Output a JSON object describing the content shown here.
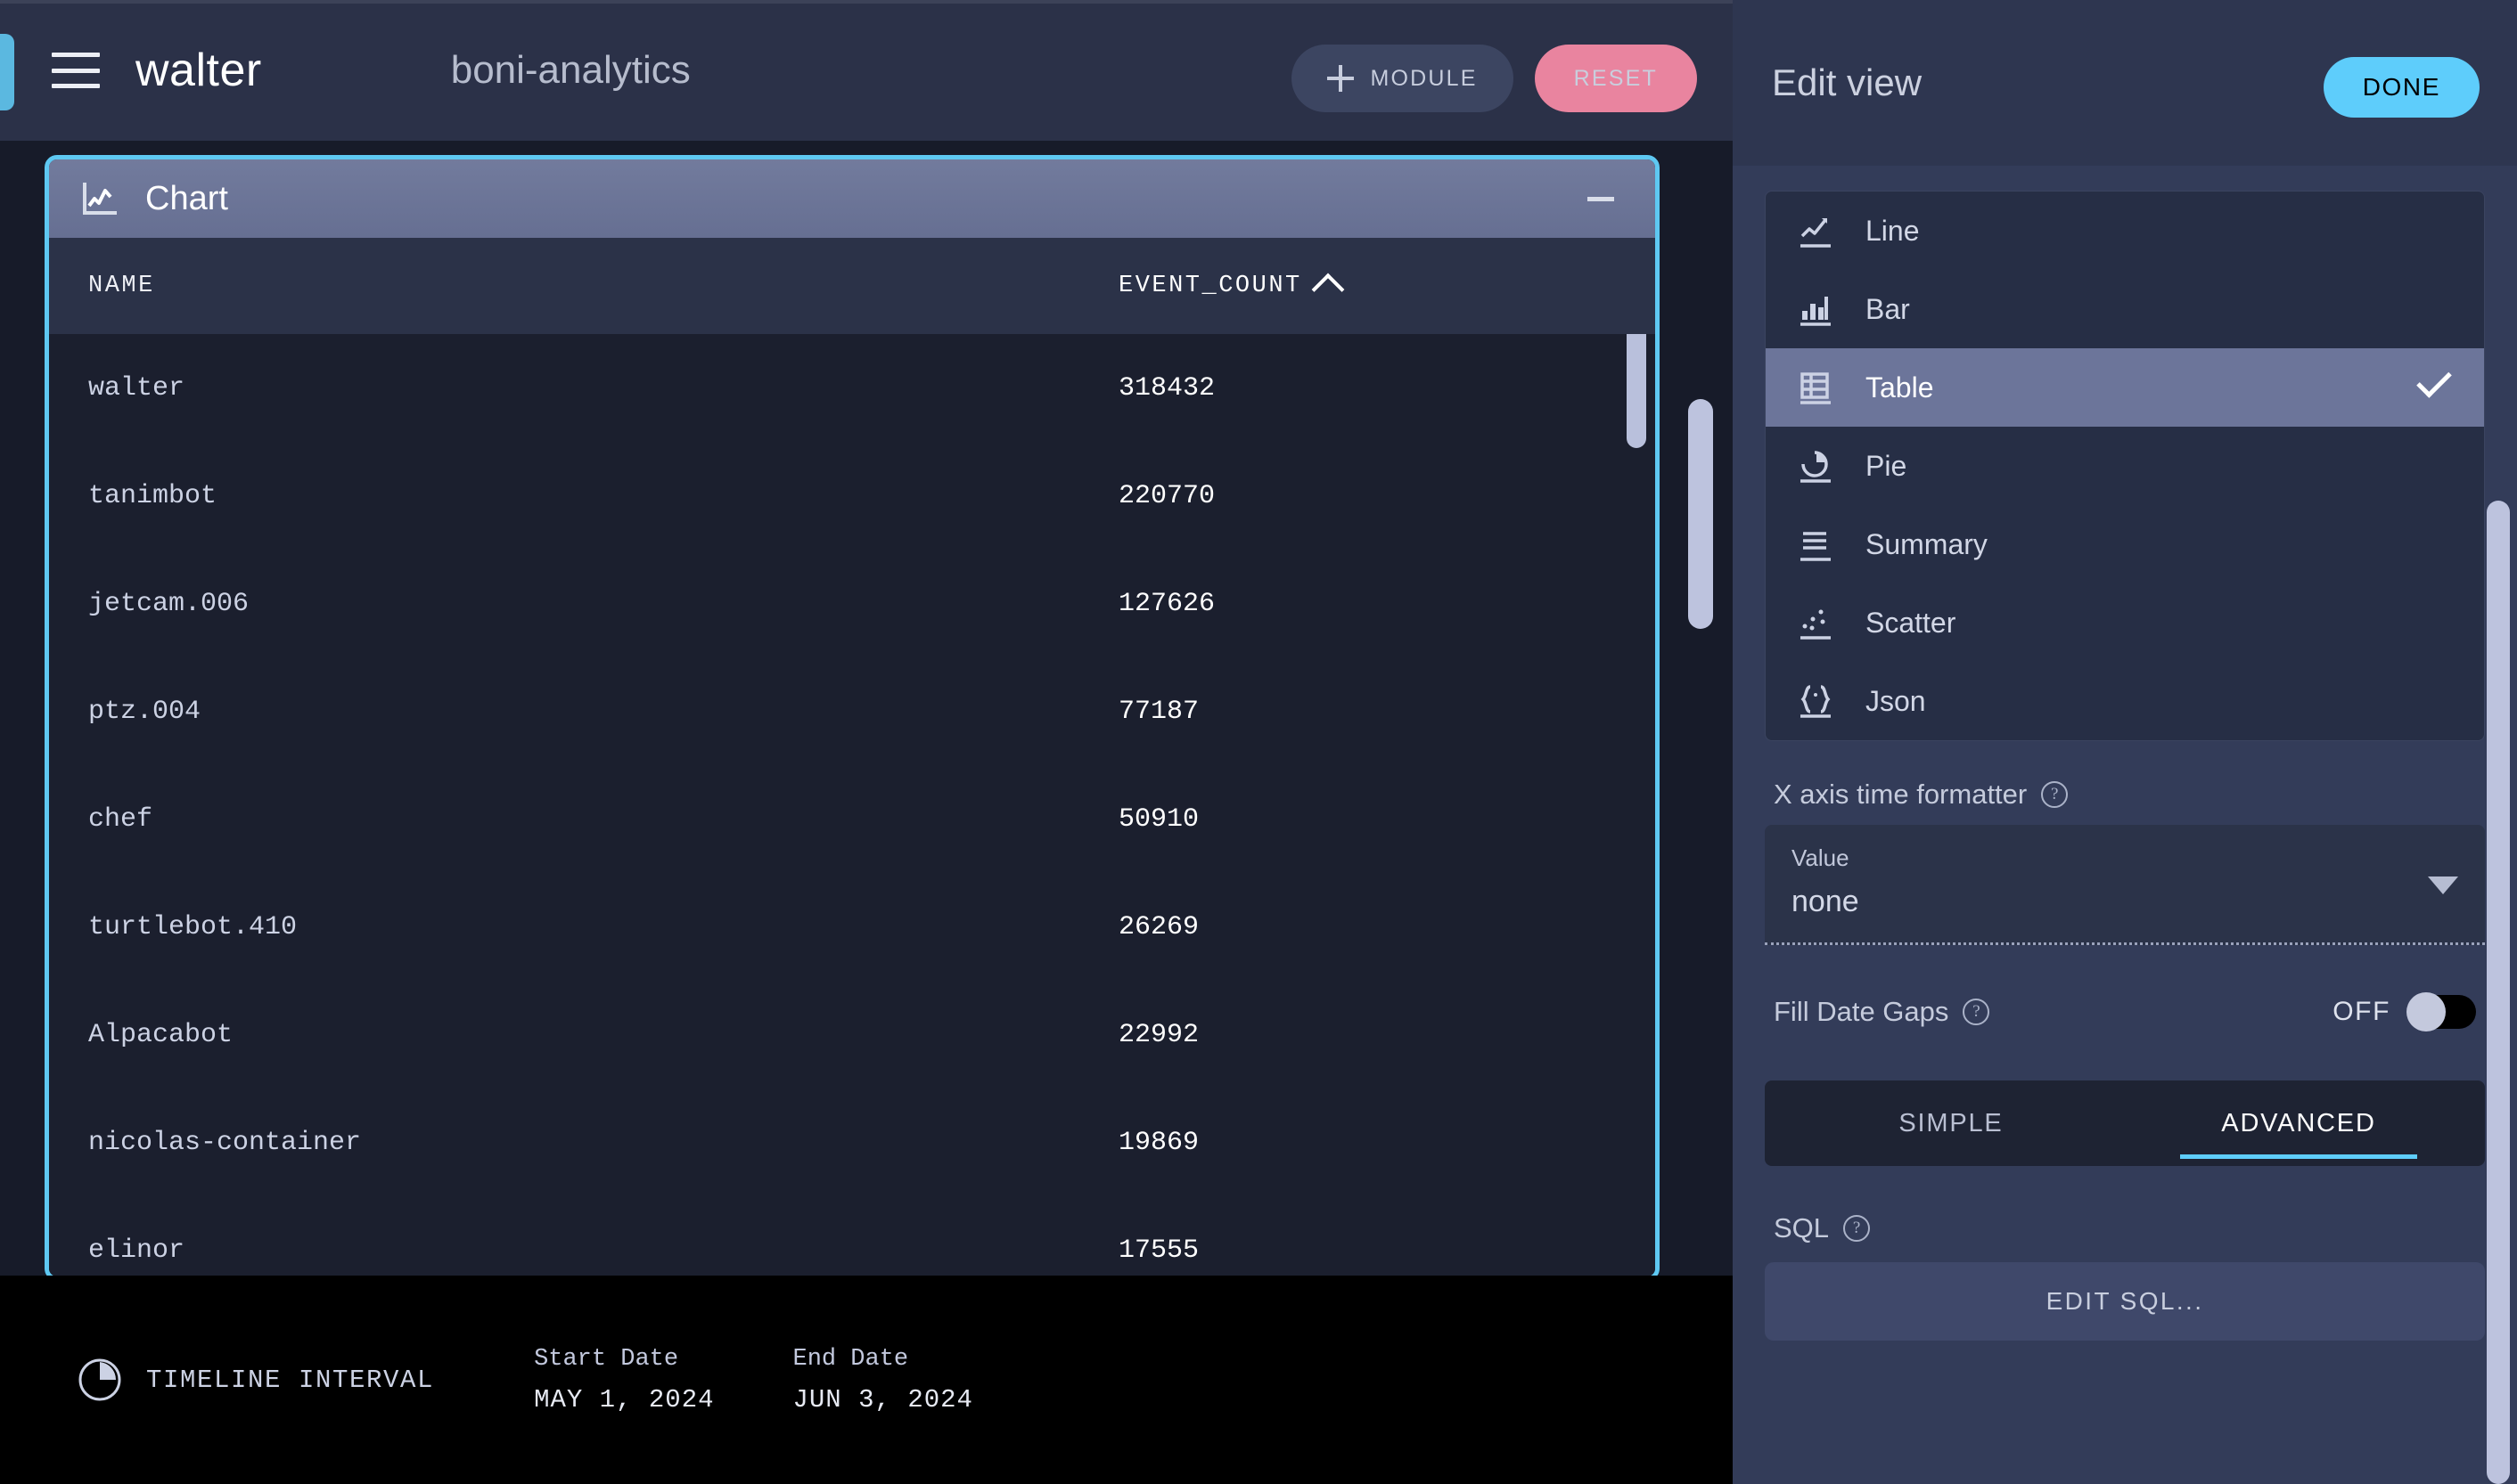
{
  "topbar": {
    "menu_icon": "hamburger-icon",
    "app_title": "walter",
    "board_title": "boni-analytics",
    "module_button": "MODULE",
    "reset_button": "RESET"
  },
  "chart_module": {
    "icon": "line-chart-icon",
    "title": "Chart",
    "minimize_label": "—"
  },
  "chart_data": {
    "type": "table",
    "title": "Chart",
    "columns": [
      "NAME",
      "EVENT_COUNT"
    ],
    "sort_column": "EVENT_COUNT",
    "sort_direction": "ascending",
    "sort_icon": "chevron-up-icon",
    "categories": [
      "walter",
      "tanimbot",
      "jetcam.006",
      "ptz.004",
      "chef",
      "turtlebot.410",
      "Alpacabot",
      "nicolas-container",
      "elinor"
    ],
    "values": [
      318432,
      220770,
      127626,
      77187,
      50910,
      26269,
      22992,
      19869,
      17555
    ],
    "xlabel": "NAME",
    "ylabel": "EVENT_COUNT",
    "rows": [
      {
        "name": "walter",
        "event_count": "318432"
      },
      {
        "name": "tanimbot",
        "event_count": "220770"
      },
      {
        "name": "jetcam.006",
        "event_count": "127626"
      },
      {
        "name": "ptz.004",
        "event_count": "77187"
      },
      {
        "name": "chef",
        "event_count": "50910"
      },
      {
        "name": "turtlebot.410",
        "event_count": "26269"
      },
      {
        "name": "Alpacabot",
        "event_count": "22992"
      },
      {
        "name": "nicolas-container",
        "event_count": "19869"
      },
      {
        "name": "elinor",
        "event_count": "17555"
      }
    ]
  },
  "timeline": {
    "icon": "pie-clock-icon",
    "label": "TIMELINE INTERVAL",
    "start_label": "Start Date",
    "start_value": "MAY 1, 2024",
    "end_label": "End Date",
    "end_value": "JUN 3, 2024"
  },
  "edit_panel": {
    "title": "Edit view",
    "done_button": "DONE",
    "chart_types": [
      {
        "label": "Line",
        "icon": "line-chart-icon",
        "selected": false
      },
      {
        "label": "Bar",
        "icon": "bar-chart-icon",
        "selected": false
      },
      {
        "label": "Table",
        "icon": "table-grid-icon",
        "selected": true
      },
      {
        "label": "Pie",
        "icon": "pie-chart-icon",
        "selected": false
      },
      {
        "label": "Summary",
        "icon": "list-lines-icon",
        "selected": false
      },
      {
        "label": "Scatter",
        "icon": "scatter-plot-icon",
        "selected": false
      },
      {
        "label": "Json",
        "icon": "curly-braces-icon",
        "selected": false
      }
    ],
    "selected_check_icon": "check-icon",
    "x_axis_formatter": {
      "label": "X axis time formatter",
      "help_icon": "question-circle-icon",
      "field_label": "Value",
      "value": "none",
      "caret_icon": "chevron-down-icon"
    },
    "fill_date_gaps": {
      "label": "Fill Date Gaps",
      "help_icon": "question-circle-icon",
      "state": "OFF"
    },
    "mode_tabs": [
      {
        "label": "SIMPLE",
        "active": false
      },
      {
        "label": "ADVANCED",
        "active": true
      }
    ],
    "sql": {
      "label": "SQL",
      "help_icon": "question-circle-icon",
      "edit_button": "EDIT SQL..."
    }
  },
  "colors": {
    "accent_cyan": "#5ecdfb",
    "reset_pink": "#e9849f",
    "panel_bg": "#333c59",
    "module_header": "#6c759a",
    "main_bg": "#171b29"
  }
}
